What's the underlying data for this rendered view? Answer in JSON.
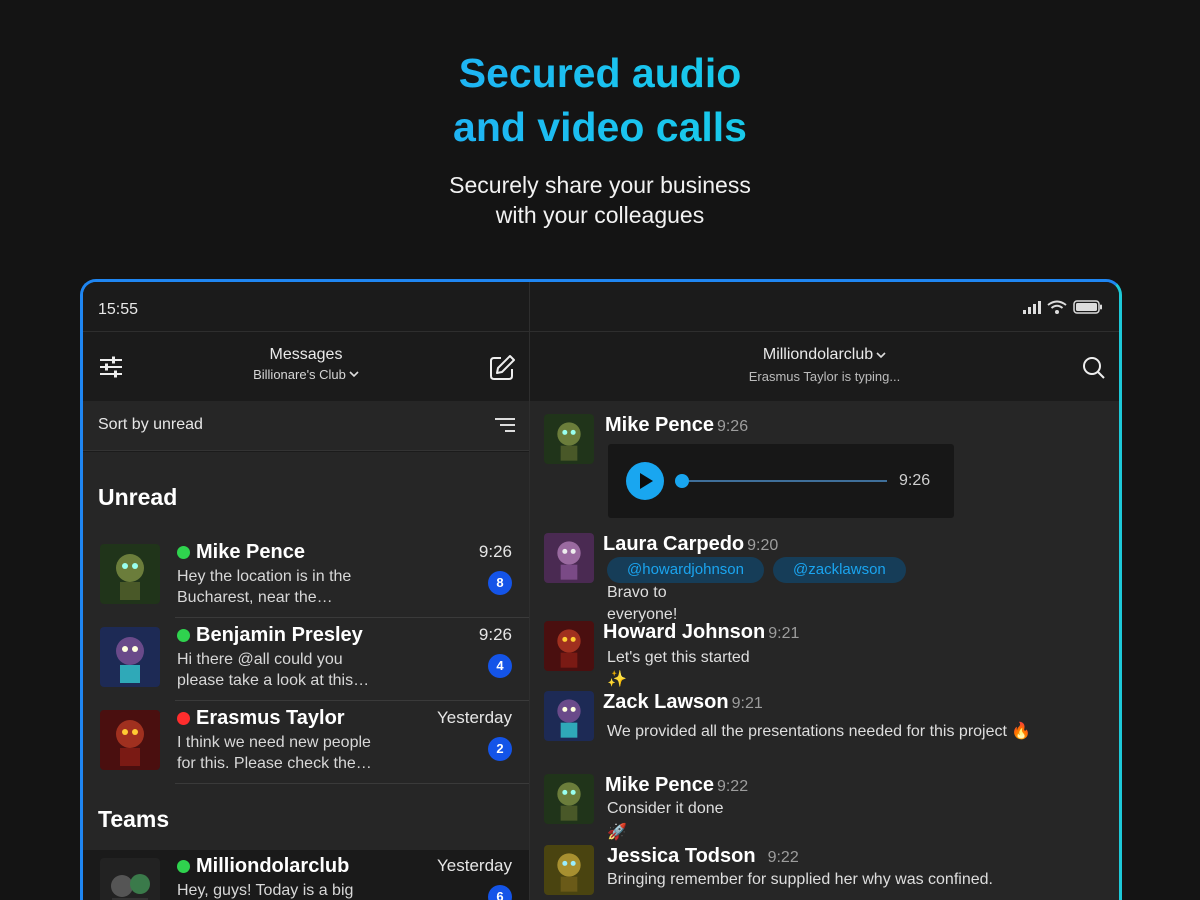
{
  "hero": {
    "title_line1": "Secured audio",
    "title_line2": "and video calls",
    "subtitle_line1": "Securely share your business",
    "subtitle_line2": "with your colleagues"
  },
  "status_bar": {
    "time": "15:55"
  },
  "left_header": {
    "title": "Messages",
    "workspace": "Billionare's Club"
  },
  "sort": {
    "label": "Sort by unread"
  },
  "sections": {
    "unread": "Unread",
    "teams": "Teams"
  },
  "chats": [
    {
      "name": "Mike Pence",
      "status": "online",
      "time": "9:26",
      "preview_line1": "Hey the location is in the",
      "preview_line2": "Bucharest, near the…",
      "unread": "8"
    },
    {
      "name": "Benjamin Presley",
      "status": "online",
      "time": "9:26",
      "preview_line1": "Hi there @all could you",
      "preview_line2": "please take a look at this…",
      "unread": "4"
    },
    {
      "name": "Erasmus Taylor",
      "status": "busy",
      "time": "Yesterday",
      "preview_line1": "I think we need new people",
      "preview_line2": "for this. Please check the…",
      "unread": "2"
    }
  ],
  "teams": [
    {
      "name": "Milliondolarclub",
      "status": "online",
      "time": "Yesterday",
      "preview_line1": "Hey, guys! Today is a big",
      "unread": "6"
    }
  ],
  "right_header": {
    "title": "Milliondolarclub",
    "typing": "Erasmus Taylor is typing..."
  },
  "messages": [
    {
      "author": "Mike Pence",
      "time": "9:26",
      "audio_duration": "9:26",
      "audio_progress": 0.0
    },
    {
      "author": "Laura Carpedo",
      "time": "9:20",
      "mentions": [
        "@howardjohnson",
        "@zacklawson"
      ],
      "line1": "Bravo to",
      "line2": "everyone!"
    },
    {
      "author": "Howard Johnson",
      "time": "9:21",
      "line1": "Let's get this started",
      "line2": "✨"
    },
    {
      "author": "Zack Lawson",
      "time": "9:21",
      "line1": "We provided all the presentations needed for this project 🔥"
    },
    {
      "author": "Mike Pence",
      "time": "9:22",
      "line1": "Consider it done",
      "line2": "🚀"
    },
    {
      "author": "Jessica Todson",
      "time": "9:22",
      "line1": "Bringing remember for supplied her why was confined."
    }
  ],
  "colors": {
    "online": "#2fd34e",
    "busy": "#ff2d2d",
    "badge": "#1454e8",
    "accent": "#19a6f0",
    "title_gradient_start": "#2a8cff",
    "title_gradient_end": "#16d9d0"
  }
}
